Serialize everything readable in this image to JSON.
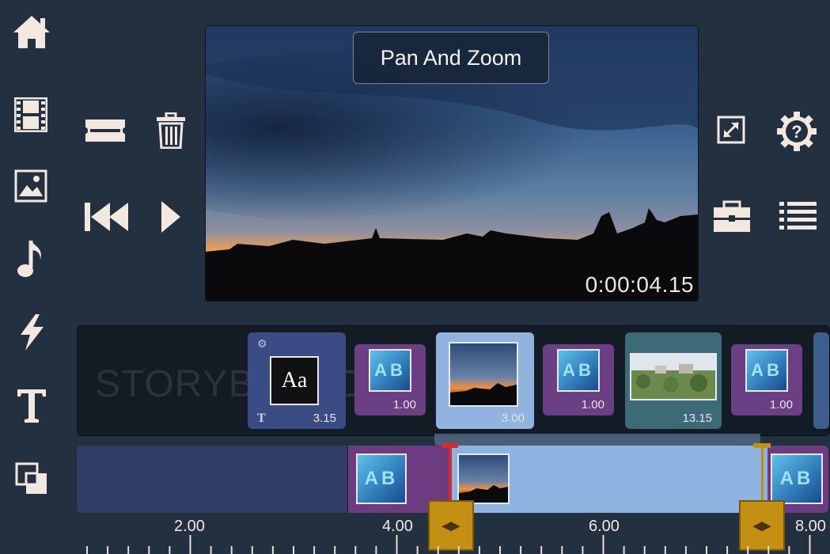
{
  "sidebar": {
    "items": [
      {
        "icon": "home-icon"
      },
      {
        "icon": "film-icon"
      },
      {
        "icon": "image-icon"
      },
      {
        "icon": "music-note-icon"
      },
      {
        "icon": "lightning-icon"
      },
      {
        "icon": "text-icon"
      },
      {
        "icon": "layers-icon"
      }
    ]
  },
  "preview": {
    "effect_label": "Pan And Zoom",
    "timecode": "0:00:04.15"
  },
  "storyboard": {
    "watermark": "STORYBOARD",
    "clips": [
      {
        "type": "title",
        "duration": "3.15",
        "thumb_text": "Aa"
      },
      {
        "type": "transition",
        "duration": "1.00",
        "thumb_text": "AB"
      },
      {
        "type": "video",
        "duration": "3.00",
        "selected": true
      },
      {
        "type": "transition",
        "duration": "1.00",
        "thumb_text": "AB"
      },
      {
        "type": "video",
        "duration": "13.15"
      },
      {
        "type": "transition",
        "duration": "1.00",
        "thumb_text": "AB"
      }
    ]
  },
  "timeline": {
    "transition_text": "AB",
    "ruler_labels": [
      "2.00",
      "4.00",
      "6.00",
      "8.00"
    ]
  },
  "colors": {
    "background": "#233040",
    "accent_handle": "#c39014",
    "selected_clip": "#90b4de",
    "transition_clip": "#6a3f84",
    "playhead": "#d52b2b"
  }
}
